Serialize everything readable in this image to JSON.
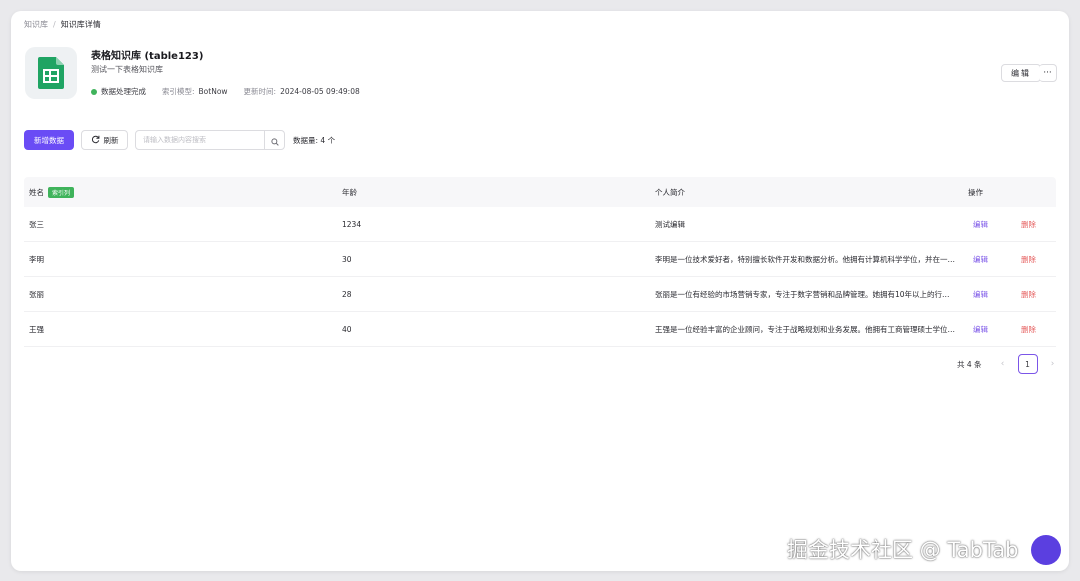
{
  "breadcrumb": {
    "root": "知识库",
    "separator": "/",
    "current": "知识库详情"
  },
  "kb": {
    "title": "表格知识库 (table123)",
    "description": "测试一下表格知识库",
    "status": "数据处理完成",
    "status_color": "#3fb35b",
    "index_model_label": "索引模型:",
    "index_model": "BotNow",
    "updated_label": "更新时间:",
    "updated": "2024-08-05 09:49:08",
    "icon": "google-sheets-icon"
  },
  "header_actions": {
    "edit_label": "编辑",
    "more_label": "···"
  },
  "toolbar": {
    "add_label": "新增数据",
    "refresh_label": "刷新",
    "search_placeholder": "请输入数据内容搜索",
    "count_text": "数据量: 4 个"
  },
  "table": {
    "columns": [
      "姓名",
      "年龄",
      "个人简介",
      "操作"
    ],
    "index_tag": "索引列",
    "rows": [
      {
        "name": "张三",
        "age": "1234",
        "bio": "测试编辑",
        "edit": "编辑",
        "delete": "删除"
      },
      {
        "name": "李明",
        "age": "30",
        "bio": "李明是一位技术爱好者，特别擅长软件开发和数据分析。他拥有计算机科学学位，并在一家...",
        "edit": "编辑",
        "delete": "删除"
      },
      {
        "name": "张丽",
        "age": "28",
        "bio": "张丽是一位有经验的市场营销专家，专注于数字营销和品牌管理。她拥有10年以上的行业经...",
        "edit": "编辑",
        "delete": "删除"
      },
      {
        "name": "王强",
        "age": "40",
        "bio": "王强是一位经验丰富的企业顾问，专注于战略规划和业务发展。他拥有工商管理硕士学位，...",
        "edit": "编辑",
        "delete": "删除"
      }
    ]
  },
  "pagination": {
    "total_text": "共 4 条",
    "current_page": "1",
    "prev": "‹",
    "next": "›"
  },
  "colors": {
    "accent": "#6a4cf5",
    "link": "#7b55e8",
    "danger": "#e55d5d",
    "success": "#3fb35b"
  },
  "watermark": "掘金技术社区 @ TabTab"
}
